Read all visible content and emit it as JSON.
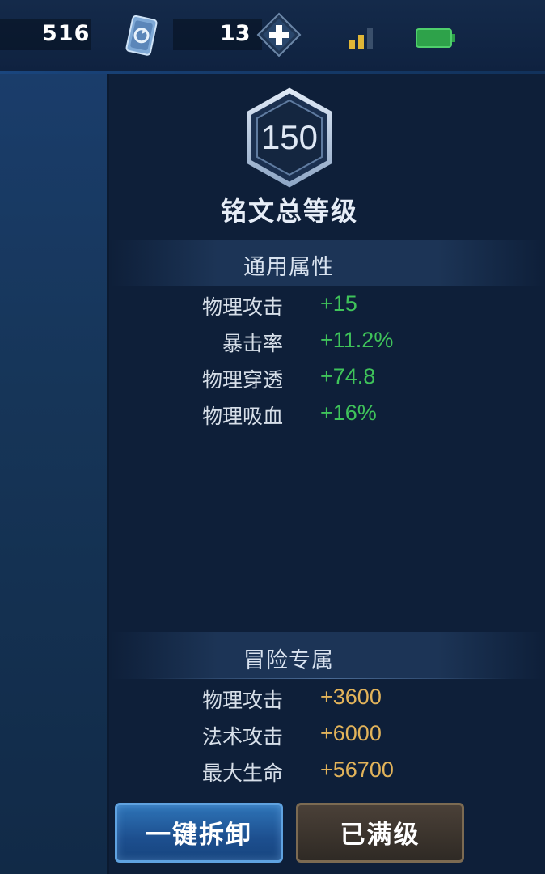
{
  "topbar": {
    "coins": "516",
    "gems": "13",
    "icons": {
      "currency": "card-currency-icon",
      "add": "plus-icon",
      "signal": "signal-icon",
      "battery": "battery-icon"
    }
  },
  "level": {
    "value": "150",
    "title": "铭文总等级"
  },
  "general": {
    "header": "通用属性",
    "stats": [
      {
        "name": "物理攻击",
        "value": "+15"
      },
      {
        "name": "暴击率",
        "value": "+11.2%"
      },
      {
        "name": "物理穿透",
        "value": "+74.8"
      },
      {
        "name": "物理吸血",
        "value": "+16%"
      }
    ]
  },
  "adventure": {
    "header": "冒险专属",
    "stats": [
      {
        "name": "物理攻击",
        "value": "+3600"
      },
      {
        "name": "法术攻击",
        "value": "+6000"
      },
      {
        "name": "最大生命",
        "value": "+56700"
      }
    ]
  },
  "buttons": {
    "disassemble": "一键拆卸",
    "maxed": "已满级"
  },
  "colors": {
    "general_value": "#3fc35a",
    "adventure_value": "#e2b35a",
    "accent": "#2e74b8"
  }
}
